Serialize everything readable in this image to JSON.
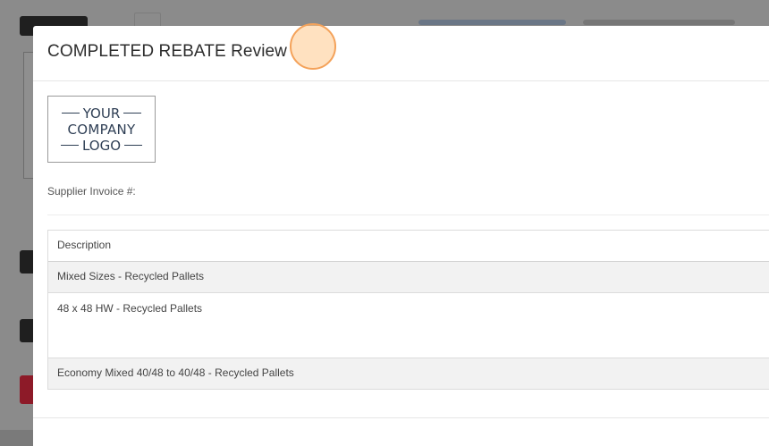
{
  "modal": {
    "title": "COMPLETED REBATE Review",
    "logo": {
      "line1": "YOUR",
      "line2": "COMPANY",
      "line3": "LOGO"
    },
    "supplier_invoice_label": "Supplier Invoice #:"
  },
  "table": {
    "header": "Description",
    "rows": [
      "Mixed Sizes - Recycled Pallets",
      "48 x 48 HW - Recycled Pallets",
      "Economy Mixed 40/48 to 40/48 - Recycled Pallets"
    ]
  }
}
